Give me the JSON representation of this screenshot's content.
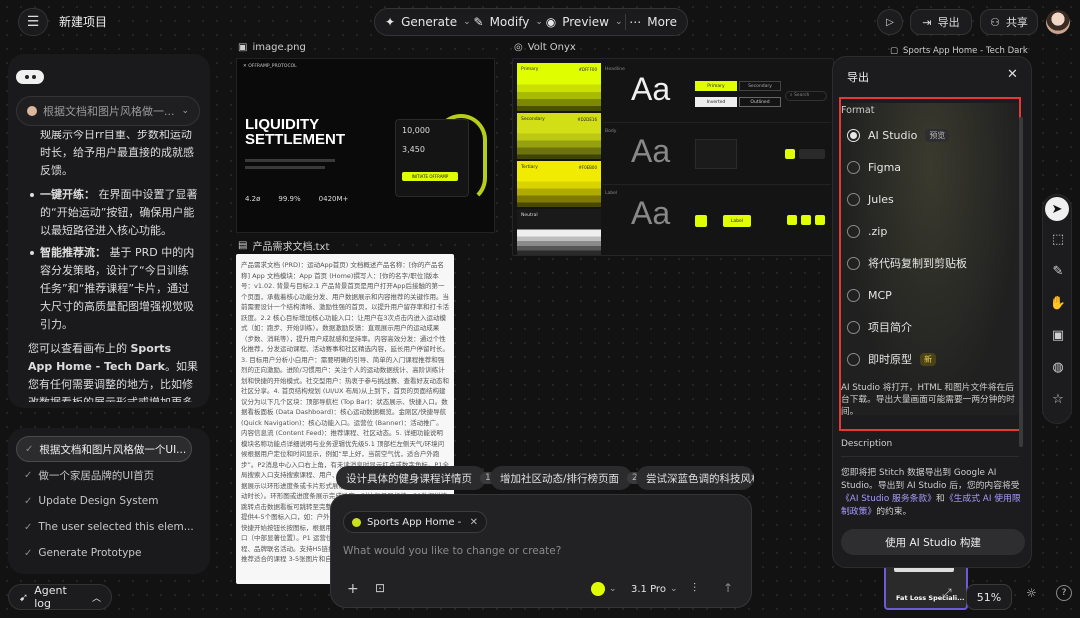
{
  "topbar": {
    "project_title": "新建项目",
    "generate_label": "Generate",
    "modify_label": "Modify",
    "preview_label": "Preview",
    "more_label": "More",
    "export_label": "导出",
    "share_label": "共享"
  },
  "sidebar": {
    "selector_placeholder": "根据文档和图片风格做一...",
    "frag1": "规展示今日rr目重、步数和运动时长，给予用户最直接的成就感反馈。",
    "b1_title": "一键开练：",
    "b1_text": "在界面中设置了显著的“开始运动”按钮，确保用户能以最短路径进入核心功能。",
    "b2_title": "智能推荐流：",
    "b2_text": "基于 PRD 中的内容分发策略，设计了“今日训练任务”和“推荐课程”卡片，通过大尺寸的高质量配图增强视觉吸引力。",
    "p_pre": "您可以查看画布上的 ",
    "p_bold": "Sports App Home - Tech Dark",
    "p_post": "。如果您有任何需要调整的地方，比如修改数据看板的展示形式或增加更多课程分类，请告诉我。"
  },
  "history": {
    "items": [
      "根据文档和图片风格做一个UI...",
      "做一个家居品牌的UI首页",
      "Update Design System",
      "The user selected this elem...",
      "Generate Prototype"
    ]
  },
  "agent_log_label": "Agent log",
  "canvas": {
    "image_label": "image.png",
    "volt_label": "Volt Onyx",
    "doc_label": "产品需求文档.txt",
    "sports_label": "Sports App Home - Tech Dark",
    "fatloss_label": "Fat Loss Speciali..."
  },
  "hero": {
    "brand": "✕ OFFRAMP_PROTOCOL",
    "title1": "LIQUIDITY",
    "title2": "SETTLEMENT",
    "stat1": "4.2ø",
    "stat2": "99.9%",
    "stat3": "0420M+",
    "amount1": "10,000",
    "amount2": "3,450",
    "cta": "INITIATE OFFRAMP"
  },
  "design_system": {
    "primary": "Primary",
    "secondary": "Secondary",
    "tertiary": "Tertiary",
    "neutral": "Neutral",
    "headline": "Headline",
    "body": "Body",
    "label": "Label",
    "aa": "Aa",
    "btn_primary": "Primary",
    "btn_secondary": "Secondary",
    "btn_inverted": "Inverted",
    "btn_outlined": "Outlined",
    "search": "Search",
    "label_btn": "Label",
    "hex1": "#DFFF00",
    "hex2": "#D2DE16",
    "hex3": "#F0EB00"
  },
  "doc_text": "产品需求文档 (PRD)：运动App首页) 文档概述产品名称：[你的产品名称] App 文档模块：App 首页 (Home)撰写人：[你的名字/职位]版本号：v1.02. 背景与目标2.1 产品背景首页是用户打开App后接触的第一个页面，承载着核心功能分发、用户数据展示和内容推荐的关键作用。当前需要设计一个结构清晰、激励性强的首页，以提升用户留存率和打卡活跃度。2.2 核心目标增加核心功能入口：让用户在3次点击内进入运动模式（如：跑步、开始训练）。数据激励反馈：直观展示用户的运动成果（步数、消耗等），提升用户成就感和坚持率。内容高效分发：通过个性化推荐，分发运动课程、活动赛事和社区精选内容，延长用户停留时长。3. 目标用户分析小白用户：需要明确的引导、简单的入门课程推荐和强烈的正向激励。进阶/习惯用户：关注个人的运动数据统计、高阶训练计划和快捷的开始模式。社交型用户：热衷于参与挑战赛、查看好友动态和社区分享。4. 首页结构规划 (UI/UX 布局)从上到下，首页的页面结构建议分为以下几个区块：顶部导航栏 (Top Bar)：状态展示、快捷入口。数据看板面板 (Data Dashboard)：核心运动数据概览。金刚区/快捷导航 (Quick Navigation)：核心功能入口。运营位 (Banner)：活动推广。内容信息流 (Content Feed)：推荐课程、社区动态。5. 详细功能说明模块名称功能点详细说明与业务逻辑优先级5.1 顶部栏左侧天气/环境问候根据用户定位和时间显示，例如“早上好，当前空气优，适合户外跑步”。P2消息中心入口右上角，有未读消息时显示红点或数字角标。P1全局搜索入口支持搜索课程、用户、话题和运动审讯。P1 数据看板核心数据展示以环形进度条或卡片形式展示当日核心数据（如：今日总步数、活动时长）。环形图或进度条展示完成进度，对比每日目标值。P0数据详情跳转点击数据看板可跳转至完整的“运动数据统计”页面。P1 金刚区入口提供4-5个图标入口，如：户外跑、骑行、健身、瑜伽、饮食记录。P0 快捷开始按钮长按图标，根据用户自身偏好设定“长期户外运动“一键入口（中部显著位置）。P1 运营位 Banner轮播图展示近期挑战赛、热门课程、品牌联名活动。支持H5链接跳转。P2 推荐课程卡片，根据用户画像推荐适合的课程 3-5张图片和自助标签。P1 信息流 个性化推荐",
  "chips": {
    "c1": "设计具体的健身课程详情页",
    "c1_count": "1",
    "c2": "增加社区动态/排行榜页面",
    "c2_count": "2",
    "c3": "尝试深蓝色调的科技风格,"
  },
  "prompt": {
    "context_chip": "Sports App Home - ...",
    "placeholder": "What would you like to change or create?",
    "model": "3.1 Pro"
  },
  "export_panel": {
    "title": "导出",
    "format_label": "Format",
    "options": [
      {
        "label": "AI Studio",
        "tag": "预览"
      },
      {
        "label": "Figma",
        "tag": ""
      },
      {
        "label": "Jules",
        "tag": ""
      },
      {
        "label": ".zip",
        "tag": ""
      },
      {
        "label": "将代码复制到剪贴板",
        "tag": ""
      },
      {
        "label": "MCP",
        "tag": ""
      },
      {
        "label": "项目简介",
        "tag": ""
      },
      {
        "label": "即时原型",
        "tag": "新"
      }
    ],
    "selected_index": 0,
    "note": "AI Studio 将打开，HTML 和图片文件将在后台下载。导出大量画面可能需要一两分钟的时间。",
    "description_label": "Description",
    "desc_pre": "您即将把 Stitch 数据导出到 Google AI Studio。导出到 AI Studio 后，您的内容将受",
    "desc_link1": "《AI Studio 服务条款》",
    "desc_mid": "和",
    "desc_link2": "《生成式 AI 使用限制政策》",
    "desc_post": "的约束。",
    "build_button": "使用 AI Studio 构建"
  },
  "zoom": "51%",
  "colors": {
    "accent_yellow": "#DFFF00",
    "highlight_red": "#e53935"
  }
}
